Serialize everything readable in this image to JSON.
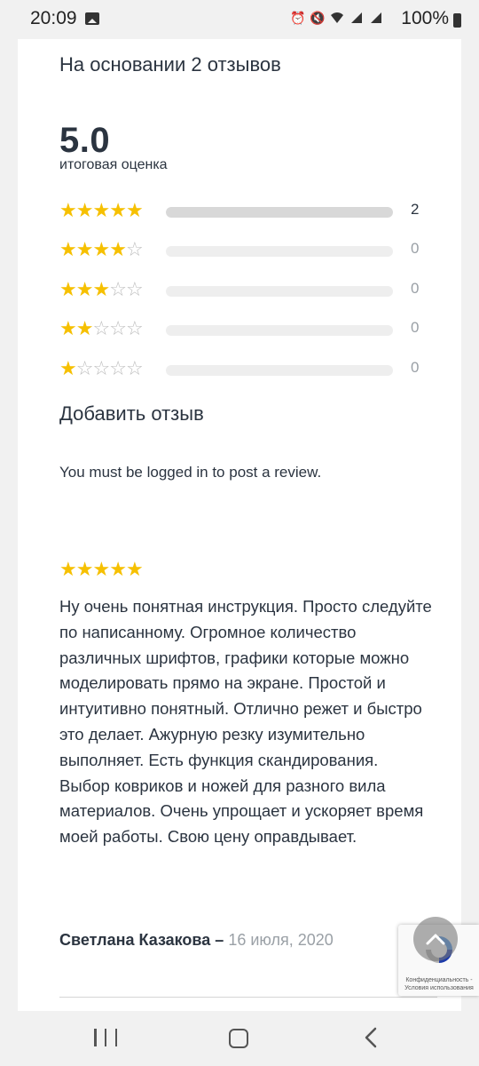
{
  "status_bar": {
    "time": "20:09",
    "battery": "100%"
  },
  "summary": {
    "title": "На основании 2 отзывов",
    "score": "5.0",
    "score_label": "итоговая оценка",
    "rows": [
      {
        "stars": 5,
        "count": "2",
        "fill": 1.0
      },
      {
        "stars": 4,
        "count": "0",
        "fill": 0
      },
      {
        "stars": 3,
        "count": "0",
        "fill": 0
      },
      {
        "stars": 2,
        "count": "0",
        "fill": 0
      },
      {
        "stars": 1,
        "count": "0",
        "fill": 0
      }
    ]
  },
  "add_review": {
    "title": "Добавить отзыв",
    "login_note": "You must be logged in to post a review."
  },
  "review": {
    "rating": 5,
    "text": "Ну очень понятная инструкция. Просто следуйте по написанному. Огромное количество различных шрифтов, графики которые можно моделировать прямо на экране. Простой и интуитивно понятный. Отлично режет и быстро это делает. Ажурную резку изумительно выполняет. Есть функция скандирования. Выбор ковриков и ножей для разного вила материалов. Очень упрощает и ускоряет время моей работы. Свою цену оправдывает.",
    "author": "Светлана Казакова",
    "dash": "–",
    "date": "16 июля, 2020"
  },
  "recaptcha": {
    "text": "Конфиденциальность - Условия использования"
  },
  "colors": {
    "star": "#f6c000",
    "text": "#2b3440",
    "muted": "#9aa0a6"
  }
}
